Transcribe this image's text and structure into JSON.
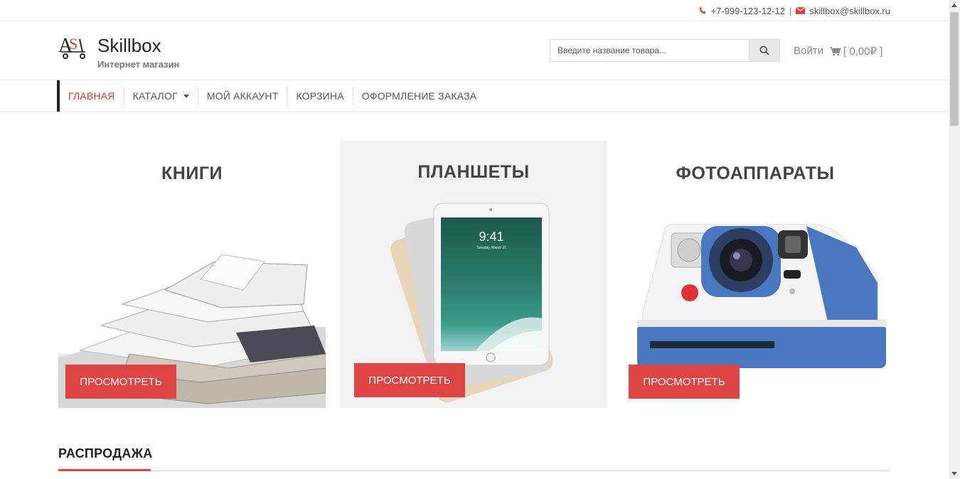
{
  "topbar": {
    "phone": "+7-999-123-12-12",
    "separator": "|",
    "email": "skillbox@skillbox.ru",
    "phone_icon": "phone-icon",
    "mail_icon": "envelope-icon"
  },
  "header": {
    "logo_title": "Skillbox",
    "logo_subtitle": "Интернет магазин",
    "search_placeholder": "Введите название товара...",
    "login_label": "Войти",
    "cart_label": "[ 0,00₽ ]"
  },
  "nav": {
    "items": [
      {
        "label": "ГЛАВНАЯ",
        "active": true
      },
      {
        "label": "КАТАЛОГ",
        "dropdown": true
      },
      {
        "label": "МОЙ АККАУНТ"
      },
      {
        "label": "КОРЗИНА"
      },
      {
        "label": "ОФОРМЛЕНИЕ ЗАКАЗА"
      }
    ]
  },
  "categories": [
    {
      "title": "КНИГИ",
      "button": "ПРОСМОТРЕТЬ"
    },
    {
      "title": "ПЛАНШЕТЫ",
      "button": "ПРОСМОТРЕТЬ"
    },
    {
      "title": "ФОТОАППАРАТЫ",
      "button": "ПРОСМОТРЕТЬ"
    }
  ],
  "tablet_screen": {
    "time": "9:41",
    "date": "Tuesday, March 21"
  },
  "sale": {
    "title": "РАСПРОДАЖА"
  },
  "colors": {
    "accent": "#de4444",
    "nav_active": "#dd3333"
  }
}
